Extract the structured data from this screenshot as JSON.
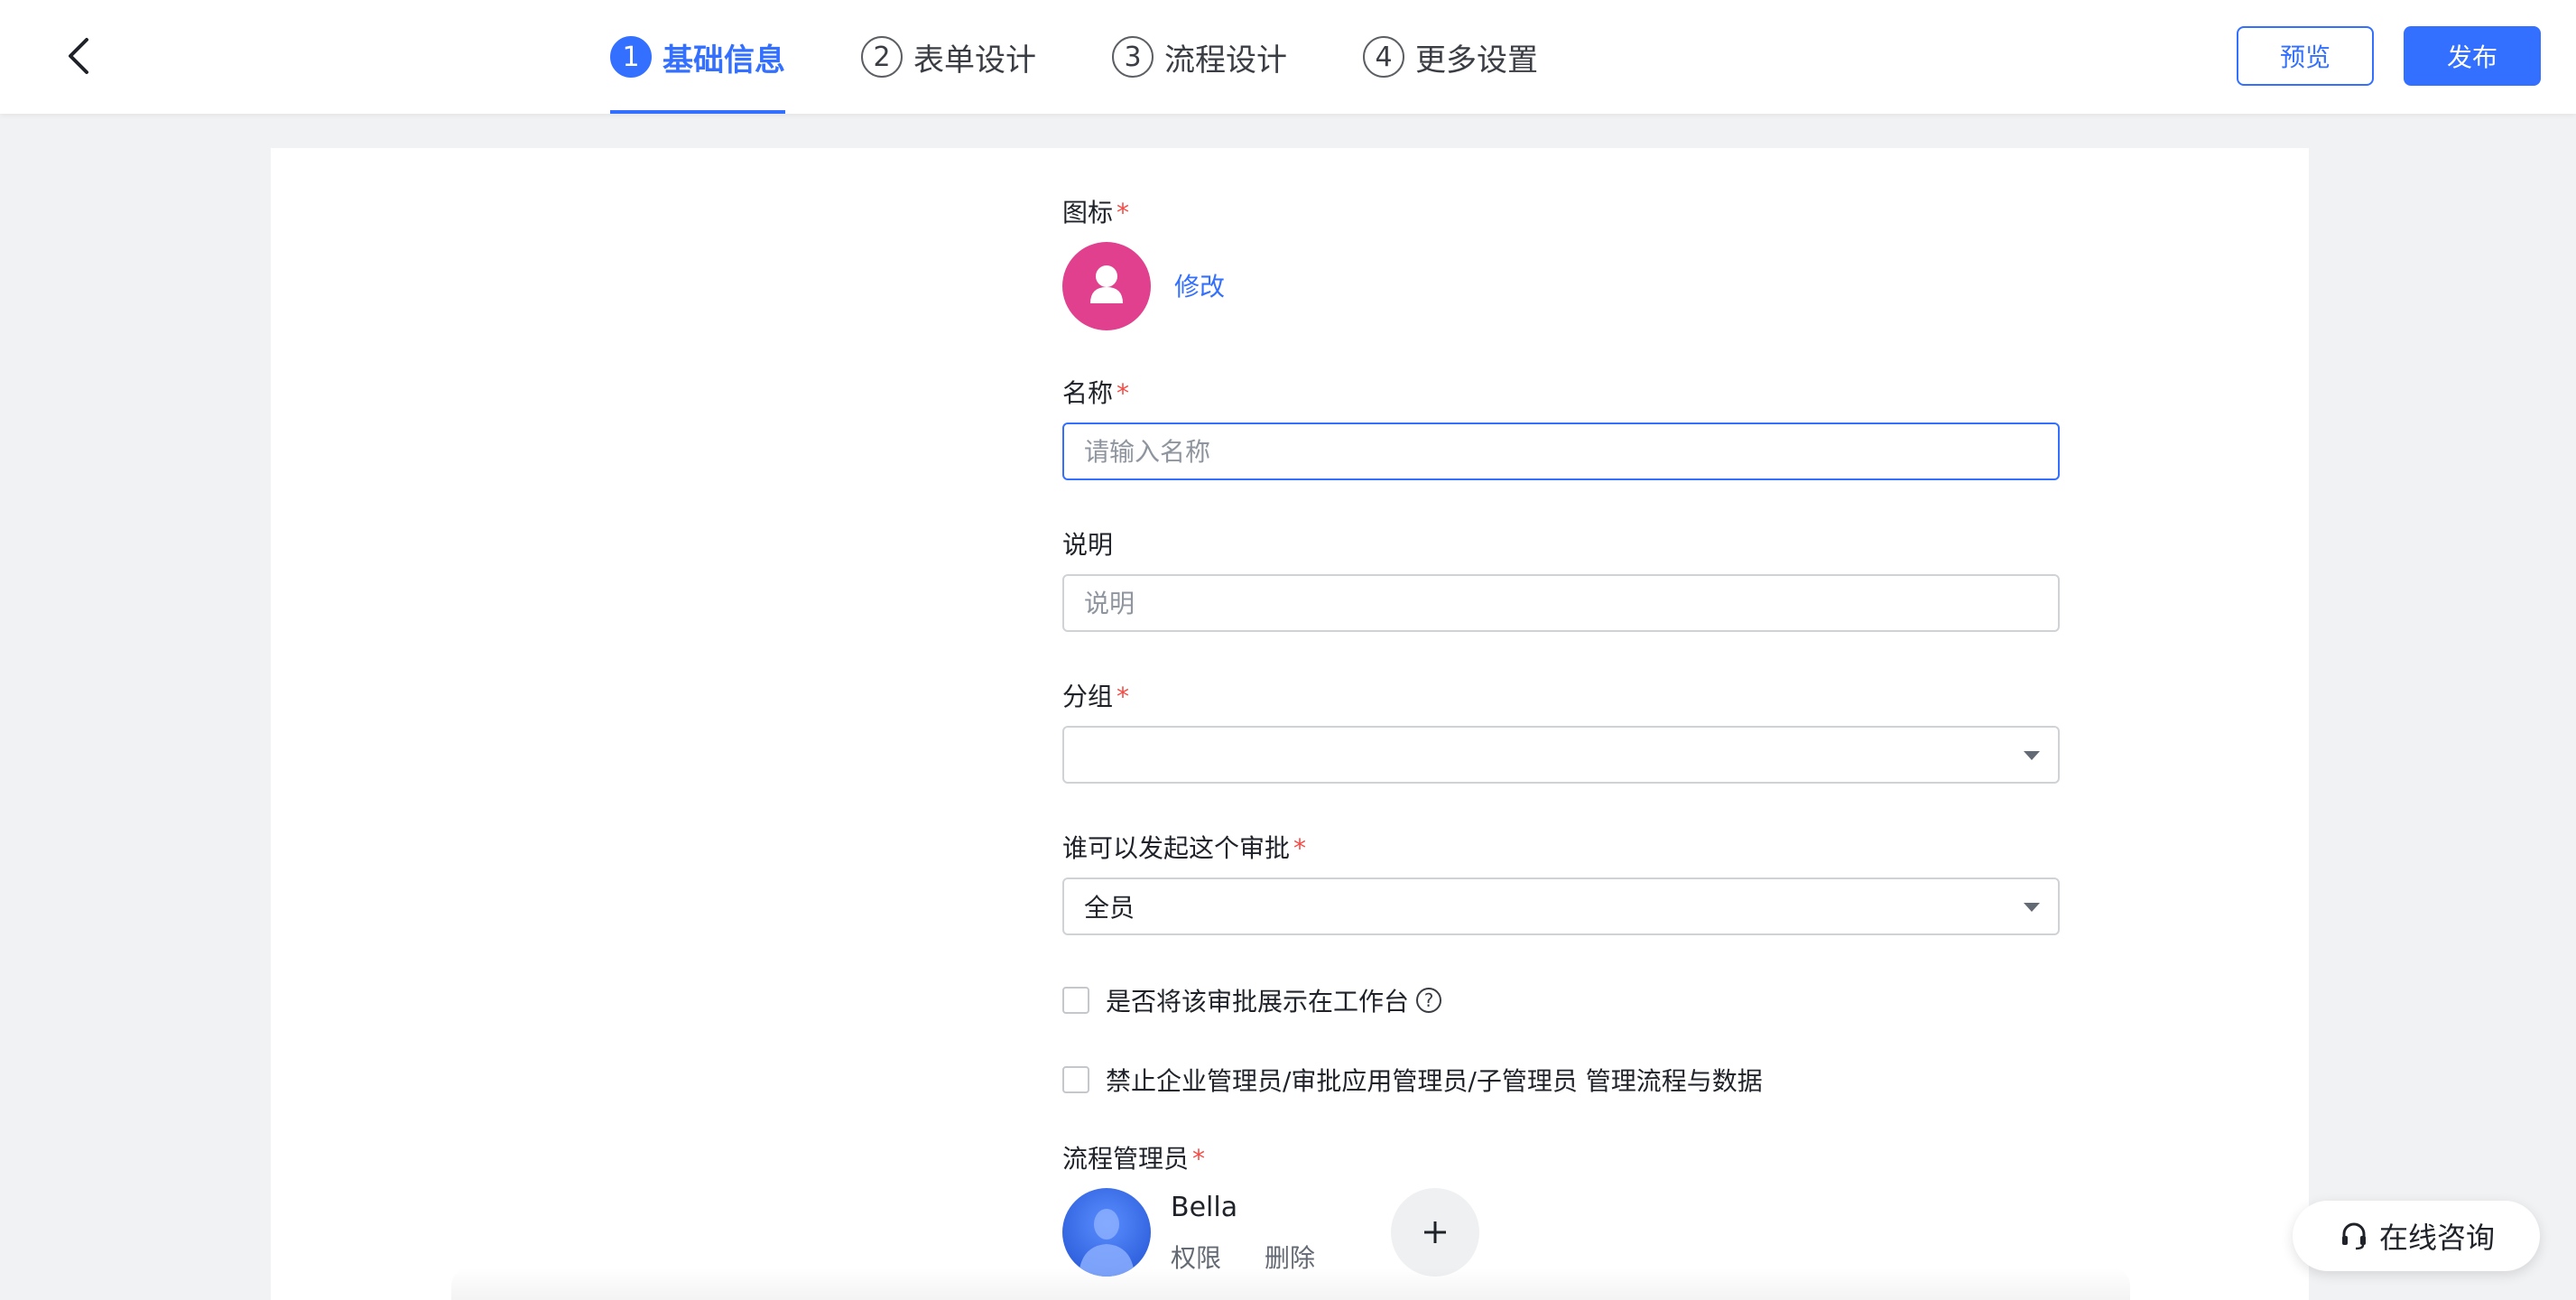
{
  "header": {
    "steps": [
      {
        "num": "1",
        "label": "基础信息",
        "active": true
      },
      {
        "num": "2",
        "label": "表单设计",
        "active": false
      },
      {
        "num": "3",
        "label": "流程设计",
        "active": false
      },
      {
        "num": "4",
        "label": "更多设置",
        "active": false
      }
    ],
    "preview_label": "预览",
    "publish_label": "发布"
  },
  "form": {
    "icon_label": "图标",
    "modify_label": "修改",
    "name_label": "名称",
    "name_placeholder": "请输入名称",
    "name_value": "",
    "desc_label": "说明",
    "desc_placeholder": "说明",
    "desc_value": "",
    "group_label": "分组",
    "group_value": "",
    "initiator_label": "谁可以发起这个审批",
    "initiator_value": "全员",
    "show_on_workbench_label": "是否将该审批展示在工作台",
    "forbid_admin_label": "禁止企业管理员/审批应用管理员/子管理员 管理流程与数据",
    "required_mark": "*",
    "admins_label": "流程管理员",
    "admins": [
      {
        "name": "Bella",
        "permission_label": "权限",
        "delete_label": "删除"
      }
    ]
  },
  "consult_label": "在线咨询",
  "colors": {
    "accent": "#3370ff",
    "app_icon": "#e0408e",
    "required": "#f54a45"
  },
  "icons": {
    "back": "chevron-left-icon",
    "app": "person-icon",
    "help": "question-circle-icon",
    "add": "plus-icon",
    "consult": "headset-icon"
  }
}
